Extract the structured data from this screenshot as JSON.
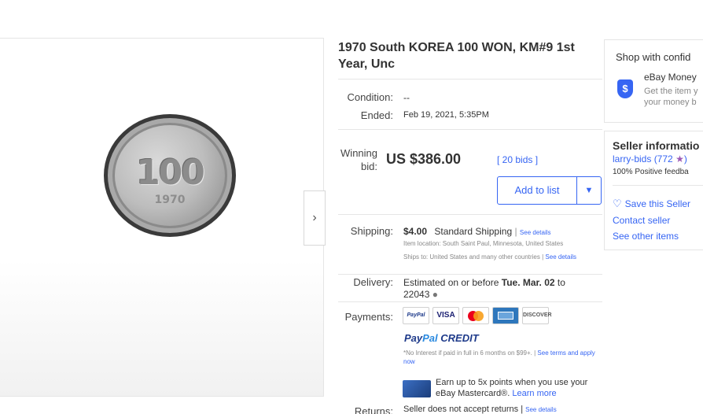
{
  "listing": {
    "title": "1970 South KOREA 100 WON, KM#9 1st Year, Unc",
    "image": {
      "denomination": "100",
      "year": "1970"
    }
  },
  "details": {
    "condition_label": "Condition:",
    "condition_value": "--",
    "ended_label": "Ended:",
    "ended_value": "Feb 19, 2021, 5:35PM",
    "winning_bid_label": "Winning bid:",
    "winning_bid_value": "US $386.00",
    "bids_link": "[ 20 bids ]",
    "add_to_list": "Add to list",
    "shipping_label": "Shipping:",
    "shipping_price": "$4.00",
    "shipping_method": "Standard Shipping",
    "shipping_see_details": "See details",
    "item_location": "Item location:  South Saint Paul, Minnesota, United States",
    "ships_to": "Ships to:  United States and many other countries |",
    "ships_to_see_details": "See details",
    "delivery_label": "Delivery:",
    "delivery_text": "Estimated on or before",
    "delivery_date": "Tue. Mar. 02",
    "delivery_to": "to",
    "delivery_zip": "22043",
    "payments_label": "Payments:",
    "payment_methods": [
      "PayPal",
      "VISA",
      "Mastercard",
      "American Express",
      "Discover"
    ],
    "paypal_credit": {
      "pay": "Pay",
      "pal": "Pal",
      "credit": "CREDIT"
    },
    "paypal_credit_note": "*No Interest if paid in full in 6 months on $99+. |",
    "paypal_credit_link": "See terms and apply now",
    "mastercard_promo": "Earn up to 5x points when you use your eBay Mastercard®.",
    "mastercard_promo_link": "Learn more",
    "returns_label": "Returns:",
    "returns_text": "Seller does not accept returns |",
    "returns_see_details": "See details"
  },
  "shop": {
    "title": "Shop with confid",
    "mbg_title": "eBay Money",
    "mbg_sub_1": "Get the item y",
    "mbg_sub_2": "your money b"
  },
  "seller": {
    "heading": "Seller informatio",
    "name": "larry-bids",
    "score": "(772",
    "feedback": "100% Positive feedba",
    "save_seller": "Save this Seller",
    "contact_seller": "Contact seller",
    "see_other_items": "See other items"
  },
  "colors": {
    "link": "#3665f3",
    "text": "#333333",
    "border": "#e5e5e5"
  }
}
